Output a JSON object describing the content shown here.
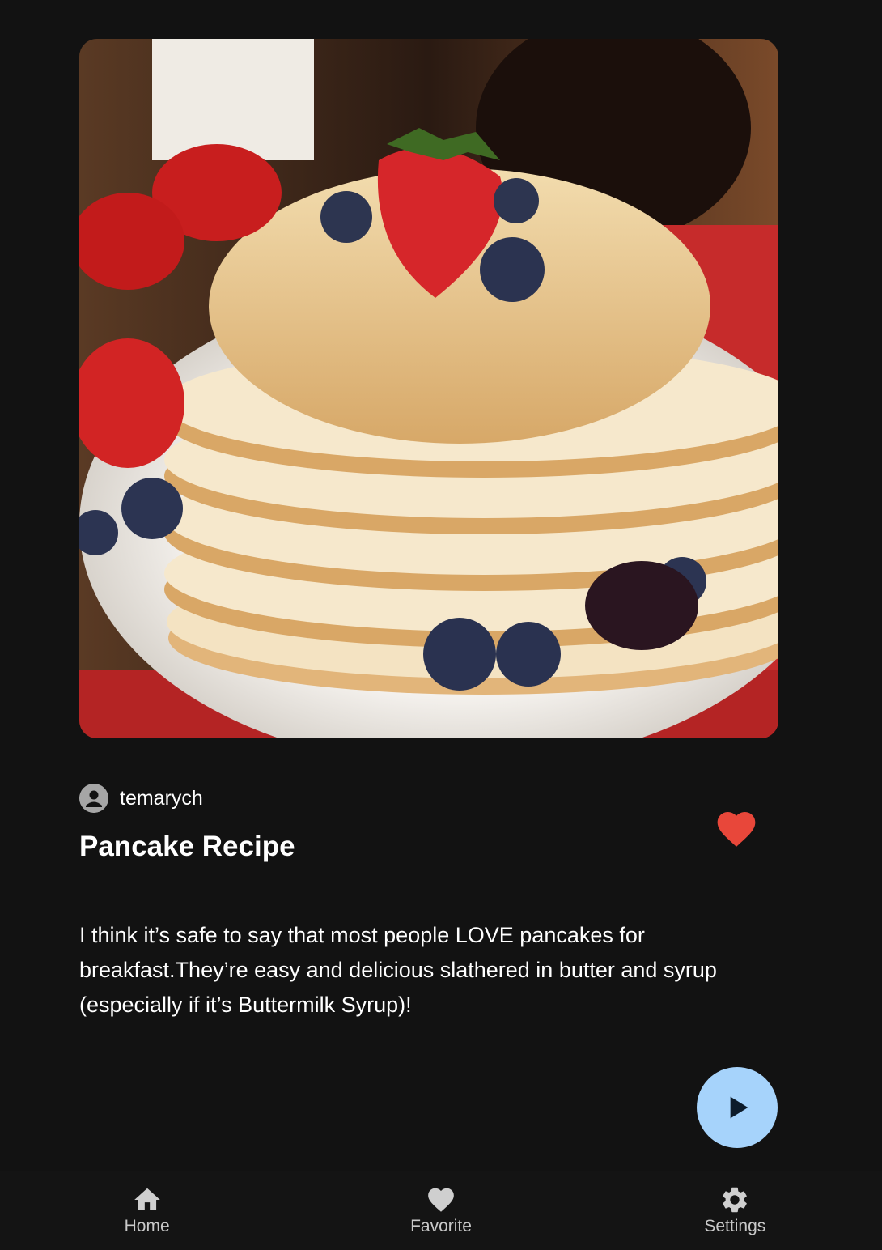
{
  "post": {
    "author": "temarych",
    "title": "Pancake Recipe",
    "description": "I think it’s safe to say that most people LOVE pancakes for breakfast.They’re easy and delicious slathered in butter and syrup (especially if it’s Buttermilk Syrup)!",
    "favorited": true,
    "image_icon": "pancake-stack-photo"
  },
  "actions": {
    "favorite_icon": "heart-icon",
    "play_icon": "play-icon"
  },
  "bottom_nav": {
    "items": [
      {
        "label": "Home",
        "icon": "home-icon"
      },
      {
        "label": "Favorite",
        "icon": "heart-icon"
      },
      {
        "label": "Settings",
        "icon": "gear-icon"
      }
    ]
  },
  "colors": {
    "background": "#121212",
    "heart": "#e8473a",
    "fab": "#a6d3fb",
    "nav_label": "#c9c9c9"
  }
}
